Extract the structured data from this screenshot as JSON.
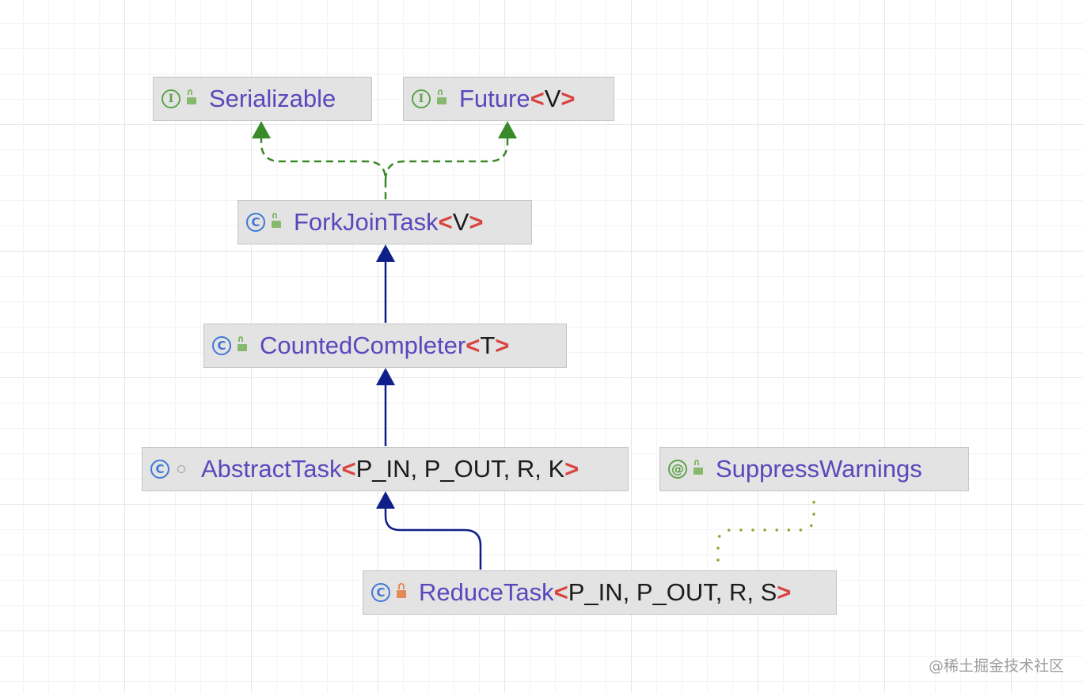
{
  "nodes": {
    "serializable": {
      "kind": "interface",
      "kind_letter": "I",
      "visibility": "public",
      "name": "Serializable",
      "params": ""
    },
    "future": {
      "kind": "interface",
      "kind_letter": "I",
      "visibility": "public",
      "name": "Future",
      "params": "V"
    },
    "forkjointask": {
      "kind": "class",
      "kind_letter": "C",
      "visibility": "public",
      "name": "ForkJoinTask",
      "params": "V"
    },
    "countedcompleter": {
      "kind": "class",
      "kind_letter": "C",
      "visibility": "public",
      "name": "CountedCompleter",
      "params": "T"
    },
    "abstracttask": {
      "kind": "class",
      "kind_letter": "C",
      "visibility": "package",
      "name": "AbstractTask",
      "params": "P_IN, P_OUT, R, K"
    },
    "suppresswarnings": {
      "kind": "annotation",
      "kind_letter": "@",
      "visibility": "public",
      "name": "SuppressWarnings",
      "params": ""
    },
    "reducetask": {
      "kind": "class",
      "kind_letter": "C",
      "visibility": "private",
      "name": "ReduceTask",
      "params": "P_IN, P_OUT, R, S"
    }
  },
  "generic_open": "<",
  "generic_close": ">",
  "relations": [
    {
      "from": "forkjointask",
      "to": "serializable",
      "type": "implements"
    },
    {
      "from": "forkjointask",
      "to": "future",
      "type": "implements"
    },
    {
      "from": "countedcompleter",
      "to": "forkjointask",
      "type": "extends"
    },
    {
      "from": "abstracttask",
      "to": "countedcompleter",
      "type": "extends"
    },
    {
      "from": "reducetask",
      "to": "abstracttask",
      "type": "extends"
    },
    {
      "from": "reducetask",
      "to": "suppresswarnings",
      "type": "annotated-by"
    }
  ],
  "colors": {
    "implements": "#3a8a2a",
    "extends": "#0f1f8a",
    "annotation_link": "#8aa838",
    "node_fill": "#e3e3e3",
    "type_name": "#5a47bd",
    "generic_bracket": "#d9433f"
  },
  "watermark": "@稀土掘金技术社区"
}
